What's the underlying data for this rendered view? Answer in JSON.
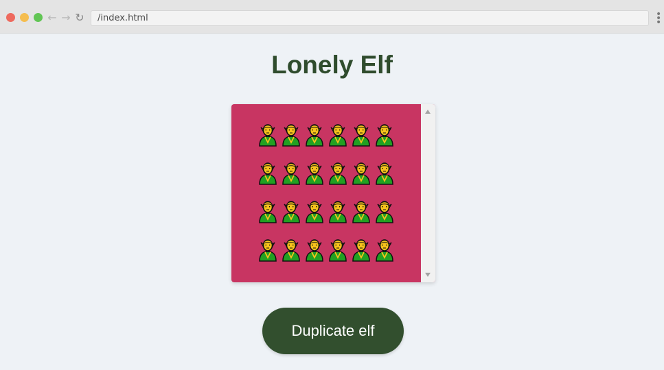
{
  "browser": {
    "url": "/index.html",
    "back_icon": "arrow-left-icon",
    "forward_icon": "arrow-right-icon",
    "reload_icon": "reload-icon",
    "menu_icon": "kebab-menu-icon"
  },
  "page": {
    "title": "Lonely Elf",
    "duplicate_label": "Duplicate elf"
  },
  "elves": {
    "count": 24,
    "emoji": "🧝",
    "icon": "elf-icon"
  },
  "colors": {
    "title": "#2f4c2d",
    "box_background": "#c83562",
    "button_background": "#324f2e",
    "page_background": "#eef2f6",
    "elf_skin": "#f6c21c",
    "elf_clothes": "#22a022"
  }
}
